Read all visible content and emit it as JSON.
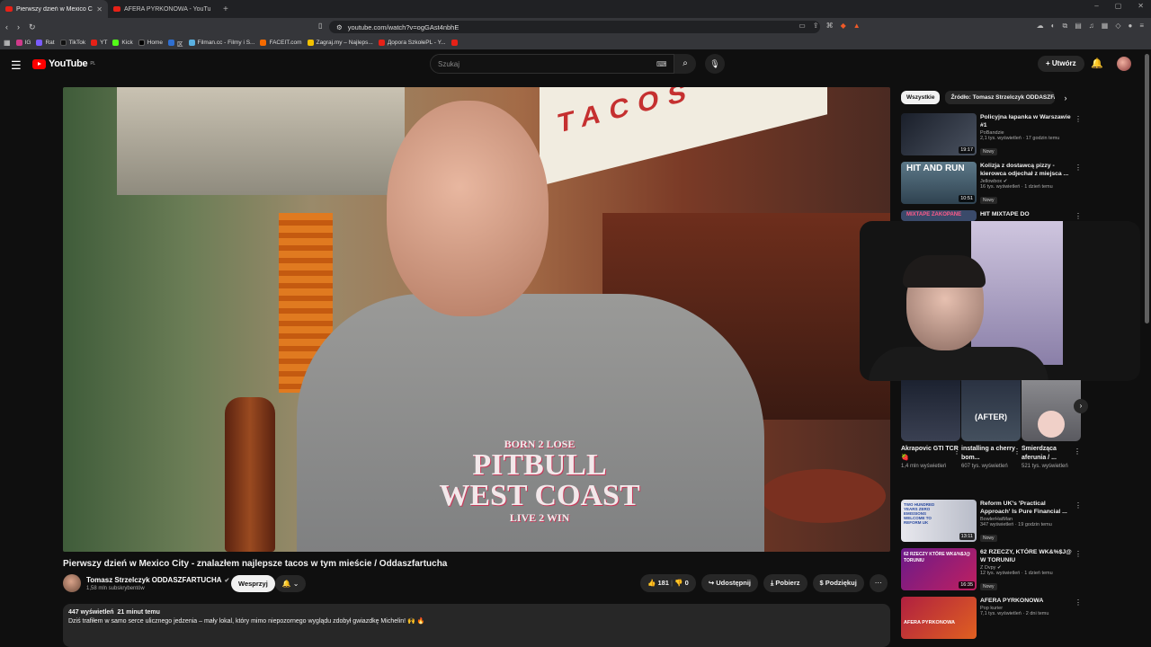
{
  "browser": {
    "tabs": [
      {
        "title": "Pierwszy dzień w Mexico City",
        "active": true
      },
      {
        "title": "AFERA PYRKONOWA - YouTube",
        "active": false
      }
    ],
    "url": "youtube.com/watch?v=ogGAst4nbhE",
    "bookmarks": [
      "IG",
      "Rat",
      "TikTok",
      "YT",
      "Kick",
      "Home",
      "区",
      "Filman.cc - Filmy i S...",
      "FACEIT.com",
      "Zagraj.my – Najleps...",
      "Дорога SzkołePL - Y..."
    ]
  },
  "header": {
    "logo_text": "YouTube",
    "region": "PL",
    "search_placeholder": "Szukaj",
    "create_label": "Utwórz"
  },
  "video": {
    "title": "Pierwszy dzień w Mexico City - znalazłem najlepsze tacos w tym mieście / Oddaszfartucha",
    "channel": "Tomasz Strzelczyk ODDASZFARTUCHA",
    "subscribers": "1,58 mln subskrybentów",
    "support_label": "Wesprzyj",
    "likes": "181",
    "dislikes": "0",
    "share_label": "Udostępnij",
    "download_label": "Pobierz",
    "thanks_label": "Podziękuj",
    "views": "447 wyświetleń",
    "time": "21 minut temu",
    "description": "Dziś trafiłem w samo serce ulicznego jedzenia – mały lokal, który mimo niepozornego wyglądu zdobył gwiazdkę Michelin! 🙌 🔥",
    "scene": {
      "sign_text": "TACOS",
      "shirt_text": [
        "BORN 2 LOSE",
        "PITBULL",
        "WEST COAST",
        "LIVE 2 WIN"
      ]
    }
  },
  "sidebar": {
    "chips": [
      "Wszystkie",
      "Źródło: Tomasz Strzelczyk ODDASZFA"
    ],
    "recs": [
      {
        "title": "Policyjna łapanka w Warszawie #1",
        "channel": "PoBandzie",
        "stats": "2,1 tys. wyświetleń · 17 godzin temu",
        "badge": "Nowy",
        "duration": "19:17",
        "thumb_color": "#2a2f3a"
      },
      {
        "title": "Kolizja z dostawcą pizzy - kierowca odjechał z miejsca ...",
        "channel": "Jellowbox",
        "stats": "16 tys. wyświetleń · 1 dzień temu",
        "badge": "Nowy",
        "duration": "10:51",
        "thumb_color": "#3d5a6a",
        "thumb_text": "HIT AND RUN"
      },
      {
        "title": "MIXTAPE DO",
        "channel": "",
        "stats": "",
        "badge": "",
        "duration": "",
        "thumb_color": "#3a4a6a",
        "thumb_text": "MIXTAPE ZAKOPANE"
      }
    ],
    "shorts": [
      {
        "title": "Akrapovic GTI TCR 🍓",
        "views": "1,4 mln wyświetleń",
        "color": "#2a3040"
      },
      {
        "title": "installing a cherry bom...",
        "views": "607 tys. wyświetleń",
        "color": "#303846",
        "overlay": "(AFTER)"
      },
      {
        "title": "Śmierdząca aferunia / ...",
        "views": "521 tys. wyświetleń",
        "color": "#6a6a6e"
      }
    ],
    "recs2": [
      {
        "title": "Reform UK's 'Practical Approach' Is Pure Financial ...",
        "channel": "BowlerHatMan",
        "stats": "347 wyświetleń · 19 godzin temu",
        "badge": "Nowy",
        "duration": "13:11",
        "thumb_color": "#d8d8e0",
        "thumb_text": "TWO HUNDRED YEARS ZERO EMISSIONS WELCOME TO REFORM UK"
      },
      {
        "title": "62 RZECZY, KTÓRE WK&%$J@ W TORUNIU",
        "channel": "Z Dvpy",
        "stats": "12 tys. wyświetleń · 1 dzień temu",
        "badge": "Nowy",
        "duration": "16:35",
        "thumb_color": "#7a2a8a",
        "thumb_text": "62 RZECZY KTÓRE WK&%$J@ TORUNIU"
      },
      {
        "title": "AFERA PYRKONOWA",
        "channel": "Pop kurier",
        "stats": "7,1 tys. wyświetleń · 2 dni temu",
        "badge": "",
        "duration": "",
        "thumb_color": "#b02040",
        "thumb_text": "AFERA PYRKONOWA"
      }
    ]
  }
}
